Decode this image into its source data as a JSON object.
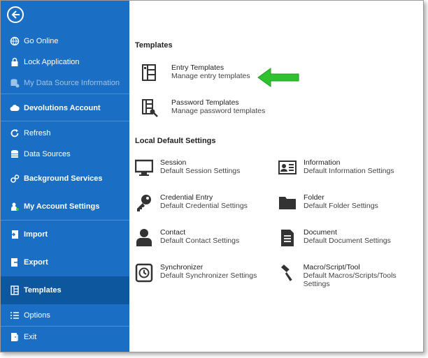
{
  "sidebar": {
    "items": [
      {
        "label": "Go Online"
      },
      {
        "label": "Lock Application"
      },
      {
        "label": "My Data Source Information"
      },
      {
        "label": "Devolutions Account"
      },
      {
        "label": "Refresh"
      },
      {
        "label": "Data Sources"
      },
      {
        "label": "Background Services"
      },
      {
        "label": "My Account Settings"
      },
      {
        "label": "Import"
      },
      {
        "label": "Export"
      },
      {
        "label": "Templates"
      },
      {
        "label": "Options"
      },
      {
        "label": "Exit"
      }
    ]
  },
  "main": {
    "templates_title": "Templates",
    "templates": [
      {
        "title": "Entry Templates",
        "subtitle": "Manage entry templates",
        "icon": "entry-template-icon"
      },
      {
        "title": "Password Templates",
        "subtitle": "Manage password templates",
        "icon": "password-template-icon"
      }
    ],
    "local_title": "Local Default Settings",
    "local": [
      {
        "title": "Session",
        "subtitle": "Default Session Settings",
        "icon": "monitor-icon"
      },
      {
        "title": "Information",
        "subtitle": "Default Information Settings",
        "icon": "id-card-icon"
      },
      {
        "title": "Credential Entry",
        "subtitle": "Default Credential Settings",
        "icon": "key-icon"
      },
      {
        "title": "Folder",
        "subtitle": "Default Folder Settings",
        "icon": "folder-icon"
      },
      {
        "title": "Contact",
        "subtitle": "Default Contact Settings",
        "icon": "person-icon"
      },
      {
        "title": "Document",
        "subtitle": "Default Document Settings",
        "icon": "document-icon"
      },
      {
        "title": "Synchronizer",
        "subtitle": "Default Synchronizer Settings",
        "icon": "synchronizer-icon"
      },
      {
        "title": "Macro/Script/Tool",
        "subtitle": "Default Macros/Scripts/Tools Settings",
        "icon": "macro-icon"
      }
    ]
  },
  "colors": {
    "sidebar": "#1a6fc4",
    "active": "#0d579f",
    "arrow": "#2fc12f"
  }
}
